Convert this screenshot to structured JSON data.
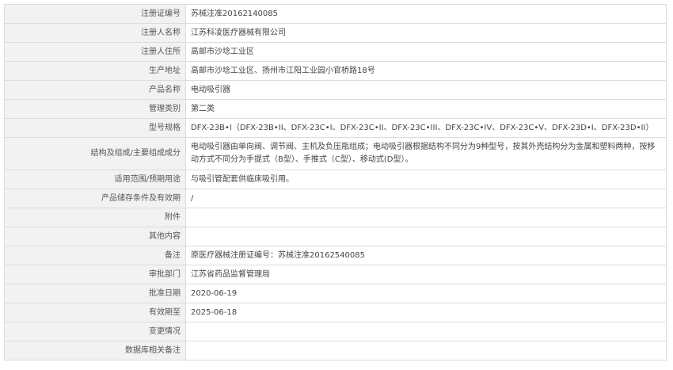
{
  "rows": [
    {
      "label": "注册证编号",
      "value": "苏械注准20162140085"
    },
    {
      "label": "注册人名称",
      "value": "江苏科凌医疗器械有限公司"
    },
    {
      "label": "注册人住所",
      "value": "高邮市沙埝工业区"
    },
    {
      "label": "生产地址",
      "value": "高邮市沙埝工业区、扬州市江阳工业园小官桥路18号"
    },
    {
      "label": "产品名称",
      "value": "电动吸引器"
    },
    {
      "label": "管理类别",
      "value": "第二类"
    },
    {
      "label": "型号规格",
      "value": "DFX-23B•I（DFX-23B•II、DFX-23C•I、DFX-23C•II、DFX-23C•III、DFX-23C•IV、DFX-23C•V、DFX-23D•I、DFX-23D•II）"
    },
    {
      "label": "结构及组成/主要组成成分",
      "value": "电动吸引器由单向阀、调节阀、主机及负压瓶组成；电动吸引器根据结构不同分为9种型号，按其外壳结构分为金属和塑料两种，按移动方式不同分为手提式（B型）、手推式（C型）、移动式(D型）。"
    },
    {
      "label": "适用范围/预期用途",
      "value": "与吸引管配套供临床吸引用。"
    },
    {
      "label": "产品储存条件及有效期",
      "value": "/"
    },
    {
      "label": "附件",
      "value": ""
    },
    {
      "label": "其他内容",
      "value": ""
    },
    {
      "label": "备注",
      "value": "原医疗器械注册证编号：苏械注准20162540085"
    },
    {
      "label": "审批部门",
      "value": "江苏省药品监督管理局"
    },
    {
      "label": "批准日期",
      "value": "2020-06-19"
    },
    {
      "label": "有效期至",
      "value": "2025-06-18"
    },
    {
      "label": "变更情况",
      "value": ""
    },
    {
      "label": "数据库相关备注",
      "value": ""
    }
  ]
}
